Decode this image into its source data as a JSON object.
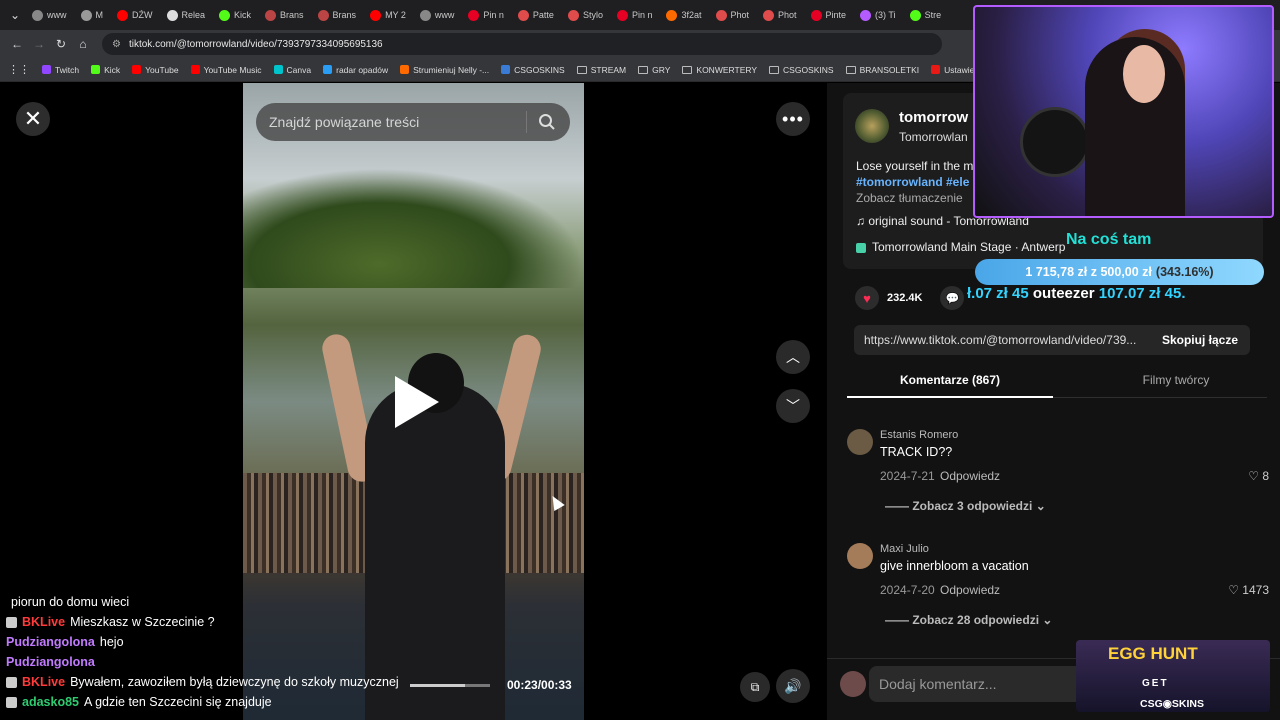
{
  "browser": {
    "tabs": [
      {
        "label": "www",
        "color": "#888"
      },
      {
        "label": "M",
        "color": "#999"
      },
      {
        "label": "DŹW",
        "color": "#ff0000"
      },
      {
        "label": "Relea",
        "color": "#ddd"
      },
      {
        "label": "Kick",
        "color": "#53fc18"
      },
      {
        "label": "Brans",
        "color": "#b44"
      },
      {
        "label": "Brans",
        "color": "#b44"
      },
      {
        "label": "MY 2",
        "color": "#ff0000"
      },
      {
        "label": "www",
        "color": "#888"
      },
      {
        "label": "Pin n",
        "color": "#e60023"
      },
      {
        "label": "Patte",
        "color": "#e04b4b"
      },
      {
        "label": "Stylo",
        "color": "#e04b4b"
      },
      {
        "label": "Pin n",
        "color": "#e60023"
      },
      {
        "label": "3f2at",
        "color": "#ff6a00"
      },
      {
        "label": "Phot",
        "color": "#e04b4b"
      },
      {
        "label": "Phot",
        "color": "#e04b4b"
      },
      {
        "label": "Pinte",
        "color": "#e60023"
      },
      {
        "label": "(3) Ti",
        "color": "#b45cff"
      },
      {
        "label": "Stre",
        "color": "#53fc18"
      }
    ],
    "url": "tiktok.com/@tomorrowland/video/7393797334095695136",
    "bookmarks": [
      {
        "label": "Twitch",
        "color": "#9146ff",
        "type": "icon"
      },
      {
        "label": "Kick",
        "color": "#53fc18",
        "type": "icon"
      },
      {
        "label": "YouTube",
        "color": "#ff0000",
        "type": "icon"
      },
      {
        "label": "YouTube Music",
        "color": "#ff0000",
        "type": "icon"
      },
      {
        "label": "Canva",
        "color": "#00c4cc",
        "type": "icon"
      },
      {
        "label": "radar opadów",
        "color": "#2a9df4",
        "type": "icon"
      },
      {
        "label": "Strumieniuj Nelly -...",
        "color": "#ff6a00",
        "type": "icon"
      },
      {
        "label": "CSGOSKINS",
        "color": "#3a7bd5",
        "type": "icon"
      },
      {
        "label": "STREAM",
        "color": "",
        "type": "folder"
      },
      {
        "label": "GRY",
        "color": "",
        "type": "folder"
      },
      {
        "label": "KONWERTERY",
        "color": "",
        "type": "folder"
      },
      {
        "label": "CSGOSKINS",
        "color": "",
        "type": "folder"
      },
      {
        "label": "BRANSOLETKI",
        "color": "",
        "type": "folder"
      },
      {
        "label": "Ustawienia strumien...",
        "color": "#e91916",
        "type": "icon"
      }
    ]
  },
  "video": {
    "search_placeholder": "Znajdź powiązane treści",
    "time": "00:23/00:33",
    "progress": 0.69
  },
  "post": {
    "author": "tomorrow",
    "author_sub": "Tomorrowlan",
    "desc": "Lose yourself in the m",
    "tags": "#tomorrowland #ele",
    "translate": "Zobacz tłumaczenie",
    "sound": "original sound - Tomorrowland",
    "location": "Tomorrowland Main Stage · Antwerp",
    "likes": "232.4K",
    "link": "https://www.tiktok.com/@tomorrowland/video/739...",
    "copy_label": "Skopiuj łącze",
    "tab_comments": "Komentarze (867)",
    "tab_creator": "Filmy twórcy"
  },
  "comments": [
    {
      "name": "Estanis Romero",
      "text": "TRACK ID??",
      "date": "2024-7-21",
      "reply": "Odpowiedz",
      "likes": "8",
      "more": "Zobacz 3 odpowiedzi",
      "avatar": "#6b5a44"
    },
    {
      "name": "Maxi Julio",
      "text": "give innerbloom a vacation",
      "date": "2024-7-20",
      "reply": "Odpowiedz",
      "likes": "1473",
      "more": "Zobacz 28 odpowiedzi",
      "avatar": "#a47c5a"
    }
  ],
  "add_comment_placeholder": "Dodaj komentarz...",
  "stream": {
    "goal_title": "Na coś tam",
    "goal_current": "1 715,78 zł",
    "goal_sep": "z",
    "goal_target": "500,00 zł",
    "goal_pct": "(343.16%)",
    "marquee_a": "ł.07 zł",
    "marquee_b": "45",
    "marquee_c": "outeezer",
    "marquee_d": "107.07 zł",
    "marquee_e": "45.",
    "promo_title": "EGG HUNT",
    "promo_get": "GET",
    "promo_brand": "CSG◉SKINS"
  },
  "chat": [
    {
      "user": "",
      "msg": "piorun do domu wieci",
      "cls": ""
    },
    {
      "user": "BKLive",
      "msg": "Mieszkasz w Szczecinie ?",
      "cls": "nm1"
    },
    {
      "user": "Pudziangolona",
      "msg": "hejo",
      "cls": "nm2"
    },
    {
      "user": "Pudziangolona",
      "msg": "",
      "cls": "nm2"
    },
    {
      "user": "BKLive",
      "msg": "Bywałem, zawoziłem byłą dziewczynę do szkoły muzycznej",
      "cls": "nm1"
    },
    {
      "user": "adasko85",
      "msg": "A gdzie ten Szczecini się znajduje",
      "cls": "nm3"
    }
  ]
}
